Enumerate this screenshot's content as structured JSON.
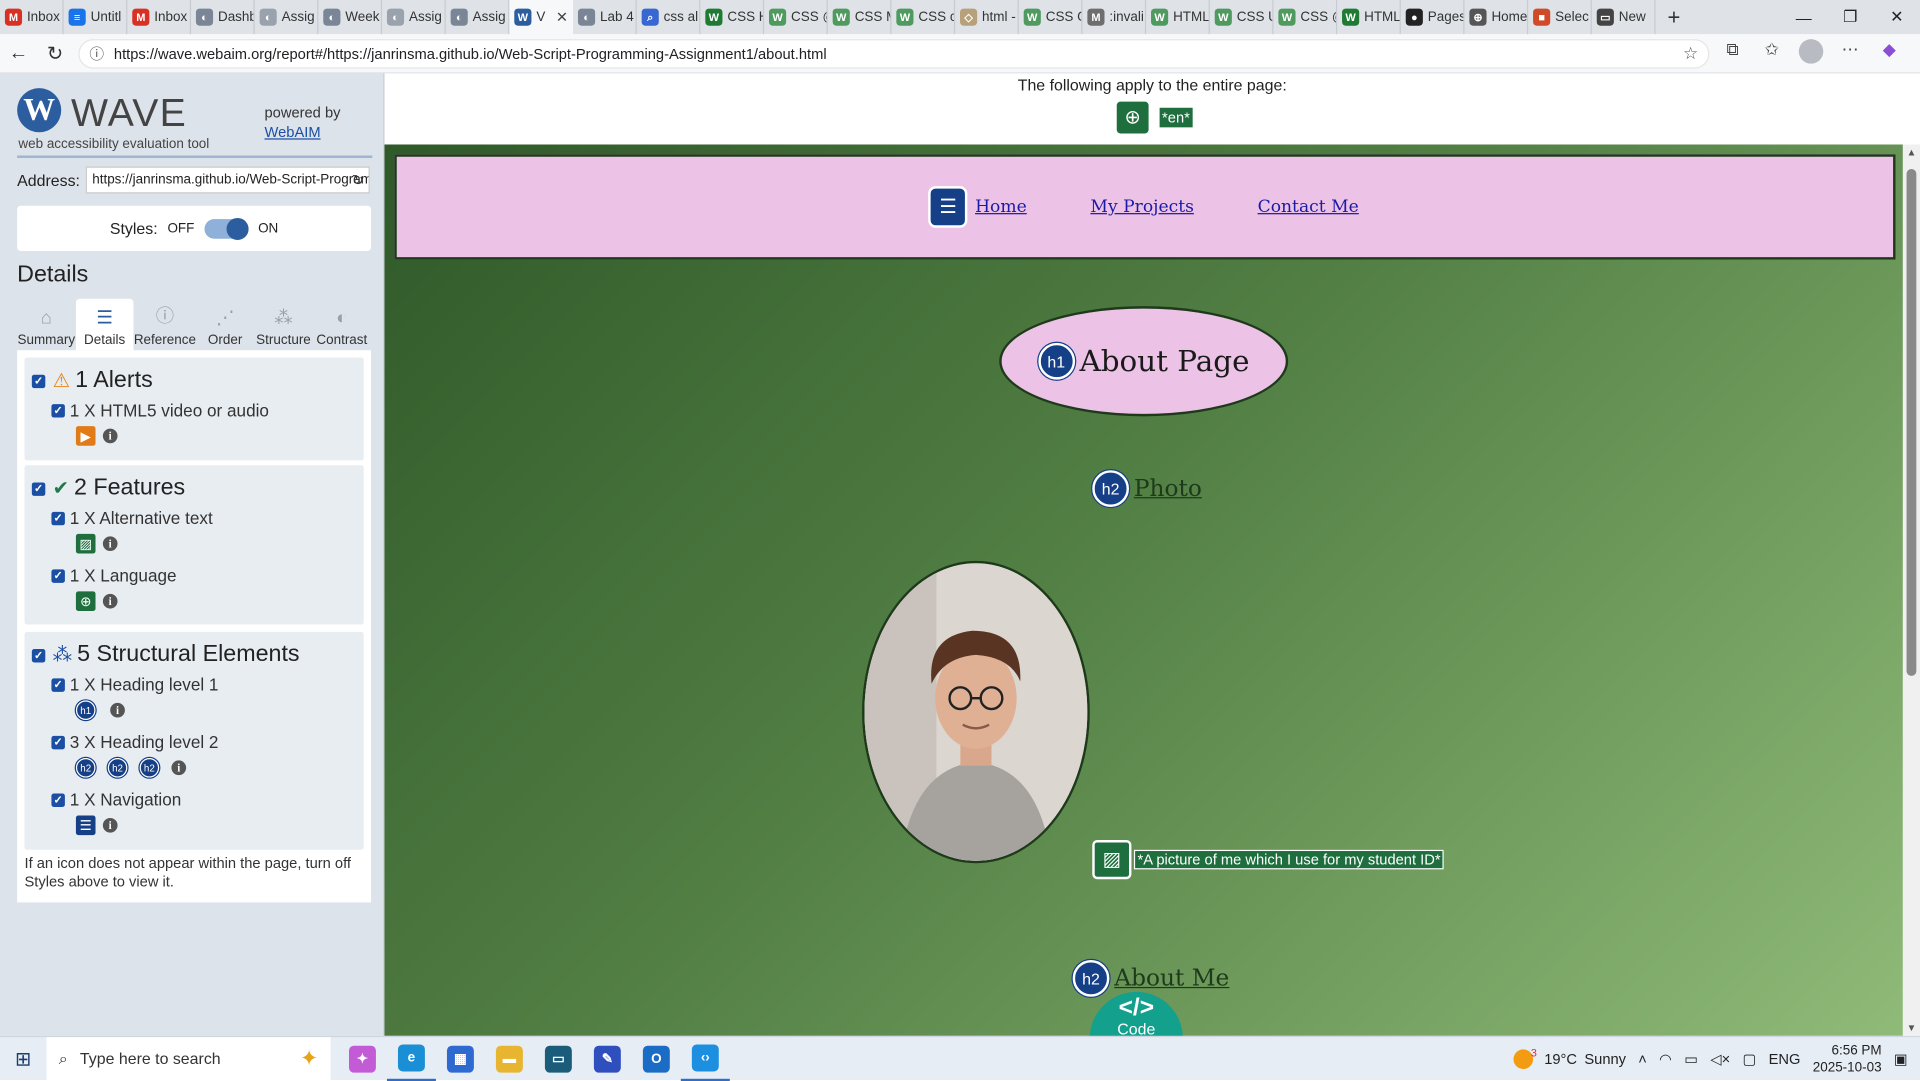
{
  "browser": {
    "tabs": [
      {
        "label": "Inbox",
        "fav": "M",
        "color": "#d93025"
      },
      {
        "label": "Untitl",
        "fav": "≡",
        "color": "#1a73e8"
      },
      {
        "label": "Inbox",
        "fav": "M",
        "color": "#d93025"
      },
      {
        "label": "Dashb",
        "fav": "◐",
        "color": "#7a8596"
      },
      {
        "label": "Assig",
        "fav": "◐",
        "color": "#9aa3ad"
      },
      {
        "label": "Week",
        "fav": "◐",
        "color": "#7a8596"
      },
      {
        "label": "Assig",
        "fav": "◐",
        "color": "#9aa3ad"
      },
      {
        "label": "Assig",
        "fav": "◐",
        "color": "#7a8596"
      },
      {
        "label": "V",
        "fav": "W",
        "color": "#2c5d9e",
        "active": true
      },
      {
        "label": "Lab 4",
        "fav": "◐",
        "color": "#7a8596"
      },
      {
        "label": "css al",
        "fav": "⌕",
        "color": "#3967d1"
      },
      {
        "label": "CSS H",
        "fav": "W",
        "color": "#1f7a34"
      },
      {
        "label": "CSS @",
        "fav": "W",
        "color": "#4f9a5e"
      },
      {
        "label": "CSS M",
        "fav": "W",
        "color": "#4f9a5e"
      },
      {
        "label": "CSS c",
        "fav": "W",
        "color": "#4f9a5e"
      },
      {
        "label": "html -",
        "fav": "◇",
        "color": "#b8a07a"
      },
      {
        "label": "CSS G",
        "fav": "W",
        "color": "#4f9a5e"
      },
      {
        "label": ":invali",
        "fav": "M",
        "color": "#6e6e6e"
      },
      {
        "label": "HTML",
        "fav": "W",
        "color": "#4f9a5e"
      },
      {
        "label": "CSS U",
        "fav": "W",
        "color": "#4f9a5e"
      },
      {
        "label": "CSS @",
        "fav": "W",
        "color": "#4f9a5e"
      },
      {
        "label": "HTML",
        "fav": "W",
        "color": "#1f7a34"
      },
      {
        "label": "Pages",
        "fav": "●",
        "color": "#222"
      },
      {
        "label": "Home",
        "fav": "⊕",
        "color": "#555"
      },
      {
        "label": "Selec",
        "fav": "■",
        "color": "#d04a2a"
      },
      {
        "label": "New",
        "fav": "▭",
        "color": "#444"
      }
    ],
    "new_tab": "+",
    "window_controls": [
      "—",
      "❐",
      "✕"
    ],
    "url": "https://wave.webaim.org/report#/https://janrinsma.github.io/Web-Script-Programming-Assignment1/about.html"
  },
  "sidebar": {
    "logo_letter": "W",
    "logo_title": "WAVE",
    "logo_subtitle": "web accessibility evaluation tool",
    "powered_by": "powered by",
    "powered_link": "WebAIM",
    "address_label": "Address:",
    "address_value": "https://janrinsma.github.io/Web-Script-Programming-Assignment1/about.html",
    "styles_label": "Styles:",
    "styles_off": "OFF",
    "styles_on": "ON",
    "details_heading": "Details",
    "tabs": [
      {
        "label": "Summary",
        "icon": "⌂"
      },
      {
        "label": "Details",
        "icon": "☰",
        "active": true
      },
      {
        "label": "Reference",
        "icon": "ⓘ"
      },
      {
        "label": "Order",
        "icon": "⋰"
      },
      {
        "label": "Structure",
        "icon": "⁂"
      },
      {
        "label": "Contrast",
        "icon": "◐"
      }
    ],
    "groups": [
      {
        "title": "1 Alerts",
        "icon": "⚠",
        "items": [
          {
            "label": "1 X HTML5 video or audio"
          }
        ]
      },
      {
        "title": "2 Features",
        "icon": "✔",
        "items": [
          {
            "label": "1 X Alternative text"
          },
          {
            "label": "1 X Language"
          }
        ]
      },
      {
        "title": "5 Structural Elements",
        "icon": "⁂",
        "items": [
          {
            "label": "1 X Heading level 1",
            "badges": [
              "h1"
            ]
          },
          {
            "label": "3 X Heading level 2",
            "badges": [
              "h2",
              "h2",
              "h2"
            ]
          },
          {
            "label": "1 X Navigation"
          }
        ]
      }
    ],
    "note": "If an icon does not appear within the page, turn off Styles above to view it."
  },
  "main": {
    "top_note": "The following apply to the entire page:",
    "lang_tag": "*en*",
    "nav_links": [
      "Home",
      "My Projects",
      "Contact Me"
    ],
    "h1_badge": "h1",
    "h1_text": "About Page",
    "h2_badge": "h2",
    "h2_photo": "Photo",
    "h2_about": "About Me",
    "alt_text": "*A picture of me which I use for my student ID*",
    "code_icon": "</>",
    "code_label": "Code"
  },
  "taskbar": {
    "search_placeholder": "Type here to search",
    "apps": [
      {
        "name": "copilot",
        "color": "#c45bd6",
        "glyph": "✦"
      },
      {
        "name": "edge",
        "color": "#1a8fd6",
        "glyph": "e",
        "active": true
      },
      {
        "name": "store",
        "color": "#2f6ad0",
        "glyph": "▦"
      },
      {
        "name": "explorer",
        "color": "#e8b530",
        "glyph": "▬"
      },
      {
        "name": "terminal",
        "color": "#1a5c7a",
        "glyph": "▭"
      },
      {
        "name": "sketch",
        "color": "#2f4fbf",
        "glyph": "✎"
      },
      {
        "name": "outlook",
        "color": "#1b6cc4",
        "glyph": "O"
      },
      {
        "name": "vscode",
        "color": "#1d8fe0",
        "glyph": "‹›",
        "active": true
      }
    ],
    "weather_badge": "3",
    "temperature": "19°C",
    "weather_text": "Sunny",
    "language": "ENG",
    "time": "6:56 PM",
    "date": "2025-10-03"
  }
}
